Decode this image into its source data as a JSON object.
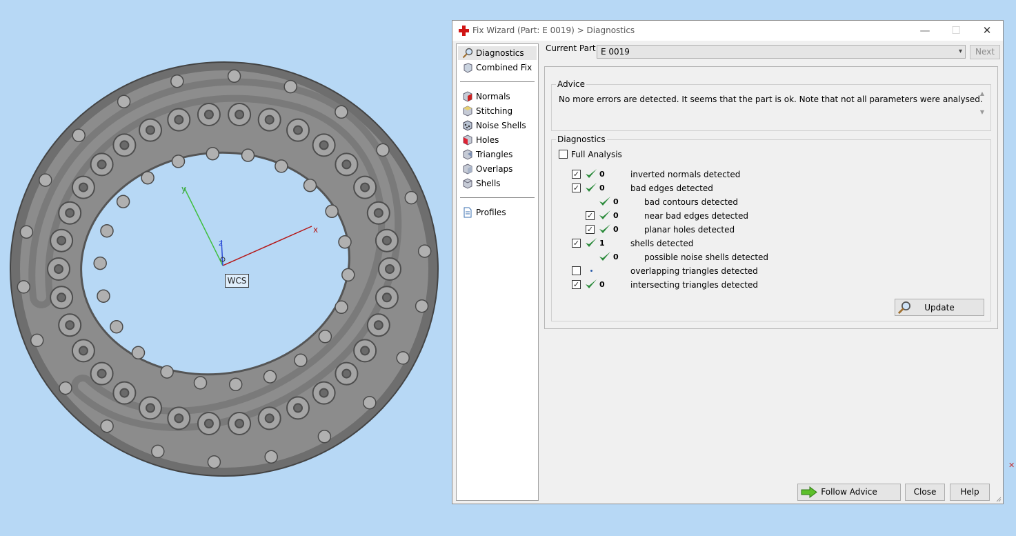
{
  "viewport": {
    "wcs_label": "WCS",
    "axes": {
      "x": "x",
      "y": "y",
      "z": "z"
    }
  },
  "dialog": {
    "title": "Fix Wizard (Part: E 0019) > Diagnostics",
    "nav": {
      "items": [
        {
          "label": "Diagnostics",
          "icon": "magnifier-icon"
        },
        {
          "label": "Combined Fix",
          "icon": "combined-fix-icon"
        },
        {
          "label": "Normals",
          "icon": "normals-cube-icon"
        },
        {
          "label": "Stitching",
          "icon": "stitching-cube-icon"
        },
        {
          "label": "Noise Shells",
          "icon": "noise-shells-icon"
        },
        {
          "label": "Holes",
          "icon": "holes-cube-icon"
        },
        {
          "label": "Triangles",
          "icon": "triangles-cube-icon"
        },
        {
          "label": "Overlaps",
          "icon": "overlaps-cube-icon"
        },
        {
          "label": "Shells",
          "icon": "shells-cube-icon"
        },
        {
          "label": "Profiles",
          "icon": "profiles-document-icon"
        }
      ]
    },
    "current_part_label": "Current Part:",
    "current_part_value": "E 0019",
    "next_label": "Next",
    "advice": {
      "title": "Advice",
      "text": "No more errors are detected. It seems that the part is ok. Note that not all parameters were analysed."
    },
    "diagnostics": {
      "title": "Diagnostics",
      "full_analysis_label": "Full Analysis",
      "rows": [
        {
          "checked": true,
          "ok": true,
          "count": "0",
          "label": "inverted normals detected"
        },
        {
          "checked": true,
          "ok": true,
          "count": "0",
          "label": "bad edges detected"
        },
        {
          "checked": null,
          "ok": true,
          "count": "0",
          "label": "bad contours detected"
        },
        {
          "checked": true,
          "ok": true,
          "count": "0",
          "label": "near bad edges detected"
        },
        {
          "checked": true,
          "ok": true,
          "count": "0",
          "label": "planar holes detected"
        },
        {
          "checked": true,
          "ok": true,
          "count": "1",
          "label": "shells detected"
        },
        {
          "checked": null,
          "ok": true,
          "count": "0",
          "label": "possible noise shells detected"
        },
        {
          "checked": false,
          "ok": false,
          "count": "",
          "label": "overlapping triangles detected"
        },
        {
          "checked": true,
          "ok": true,
          "count": "0",
          "label": "intersecting triangles detected"
        }
      ],
      "update_label": "Update"
    },
    "follow_advice_label": "Follow Advice",
    "close_label": "Close",
    "help_label": "Help"
  }
}
